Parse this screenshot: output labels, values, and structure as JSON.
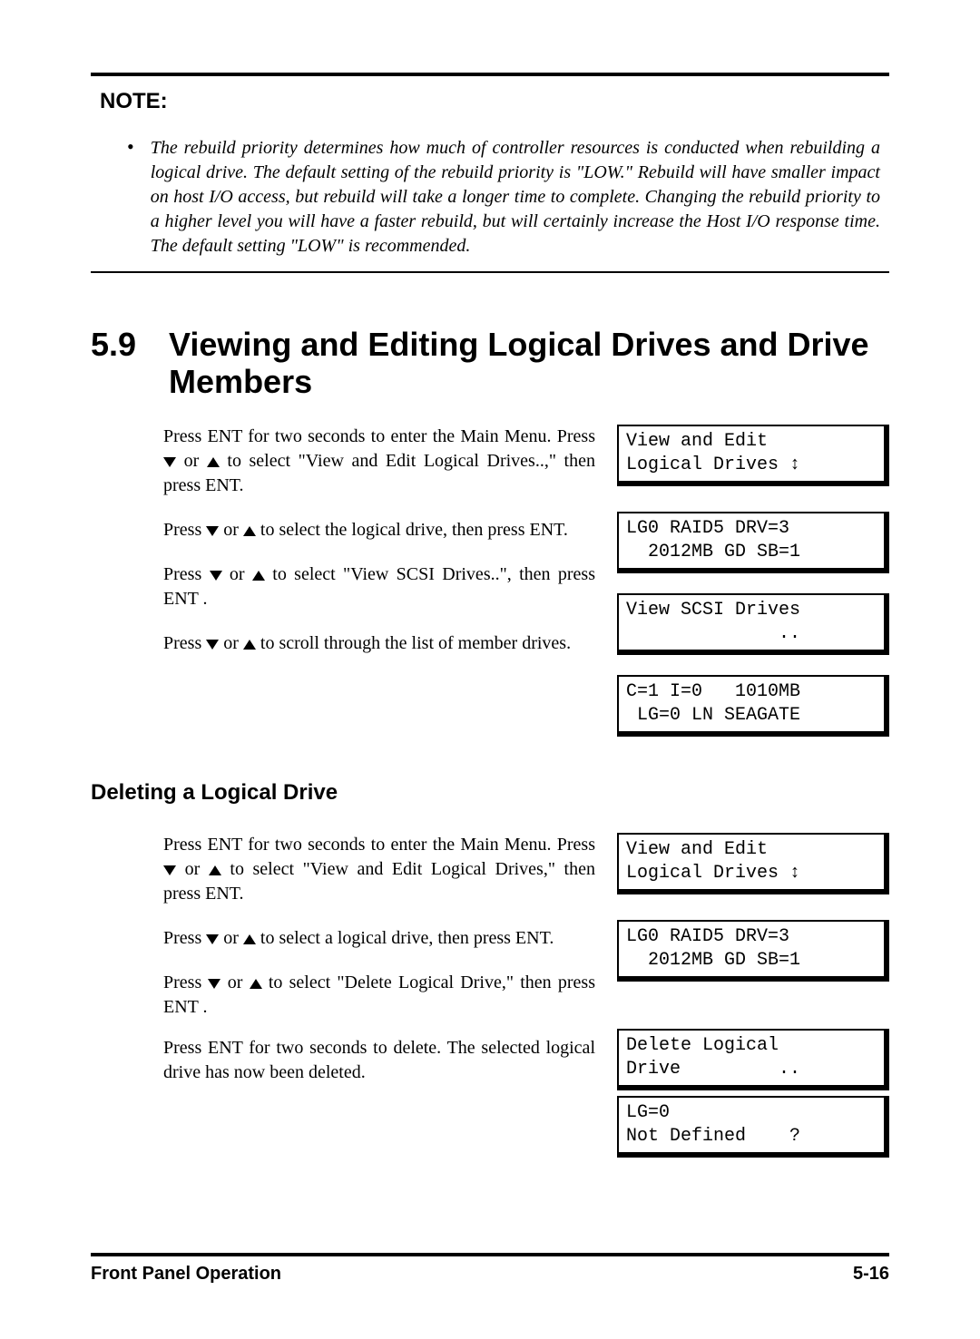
{
  "note": {
    "title": "NOTE:",
    "bullet": "•",
    "text": "The rebuild priority determines how much of controller resources is conducted when rebuilding a logical drive.  The default setting of the rebuild priority is \"LOW.\" Rebuild will have smaller impact on host I/O access, but rebuild will take a longer time to complete.  Changing the rebuild priority to a higher level you will have a faster rebuild, but will certainly increase the Host I/O response time.  The default setting \"LOW\" is recommended."
  },
  "section": {
    "number": "5.9",
    "title": "Viewing and Editing Logical Drives and Drive Members"
  },
  "view_block": {
    "p1a": "Press ENT for two seconds to enter the Main Menu. Press ",
    "p1b": " or ",
    "p1c": " to select \"View and Edit Logical Drives..,\" then press ENT.",
    "p2a": "Press ",
    "p2b": " or ",
    "p2c": " to select the logical drive, then press ENT.",
    "p3a": "Press ",
    "p3b": " or ",
    "p3c": " to select \"View SCSI Drives..\", then press ENT .",
    "p4a": "Press ",
    "p4b": " or ",
    "p4c": " to scroll through the list of member drives.",
    "lcd1": "View and Edit\nLogical Drives ↕",
    "lcd2": "LG0 RAID5 DRV=3\n  2012MB GD SB=1",
    "lcd3": "View SCSI Drives\n              ..",
    "lcd4": "C=1 I=0   1010MB\n LG=0 LN SEAGATE"
  },
  "sub": {
    "title": "Deleting a Logical Drive"
  },
  "delete_block": {
    "p1a": "Press ENT for two seconds to enter the Main Menu. Press ",
    "p1b": " or ",
    "p1c": " to select \"View and Edit Logical Drives,\" then press ENT.",
    "p2a": "Press  ",
    "p2b": " or ",
    "p2c": " to select a logical drive, then press ENT.",
    "p3a": "Press  ",
    "p3b": " or ",
    "p3c": " to select \"Delete Logical Drive,\" then press ENT .",
    "p4": "Press ENT for two seconds to delete. The selected logical drive has now been deleted.",
    "lcd1": "View and Edit\nLogical Drives ↕",
    "lcd2": "LG0 RAID5 DRV=3\n  2012MB GD SB=1",
    "lcd3": "Delete Logical\nDrive         ..",
    "lcd4": "LG=0\nNot Defined    ?"
  },
  "footer": {
    "left": "Front Panel Operation",
    "right": "5-16"
  }
}
